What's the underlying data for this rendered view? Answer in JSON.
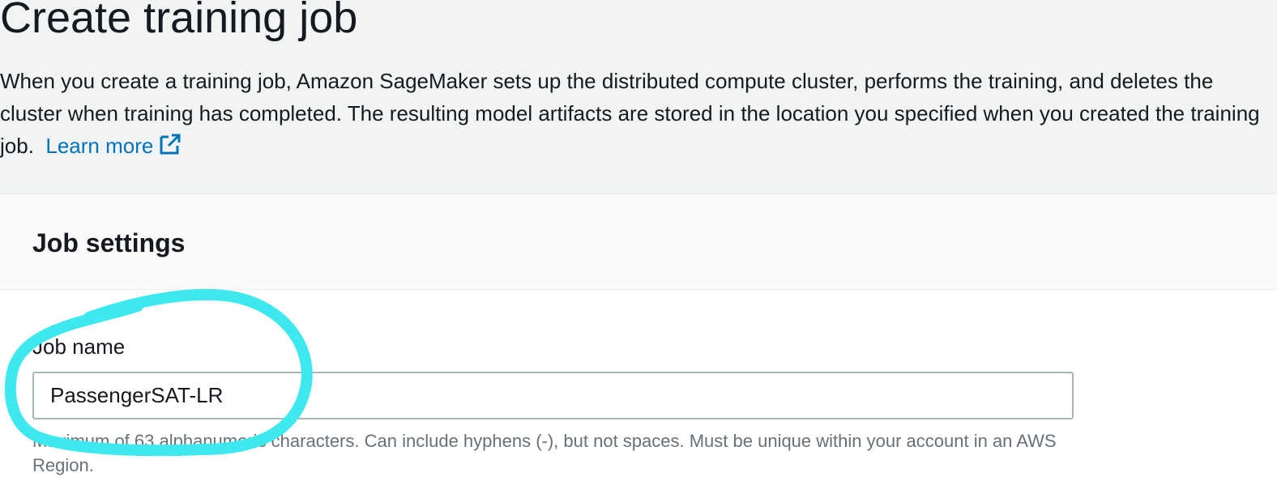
{
  "page": {
    "title": "Create training job",
    "description": "When you create a training job, Amazon SageMaker sets up the distributed compute cluster, performs the training, and deletes the cluster when training has completed. The resulting model artifacts are stored in the location you specified when you created the training job.",
    "learn_more_label": "Learn more",
    "learn_more_icon": "external-link-icon"
  },
  "job_settings": {
    "title": "Job settings",
    "job_name": {
      "label": "Job name",
      "value": "PassengerSAT-LR",
      "constraint": "Maximum of 63 alphanumeric characters. Can include hyphens (-), but not spaces. Must be unique within your account in an AWS Region."
    }
  },
  "colors": {
    "link": "#0073bb",
    "annotation": "#3ee8ef",
    "background": "#f2f3f3",
    "panel": "#ffffff"
  }
}
